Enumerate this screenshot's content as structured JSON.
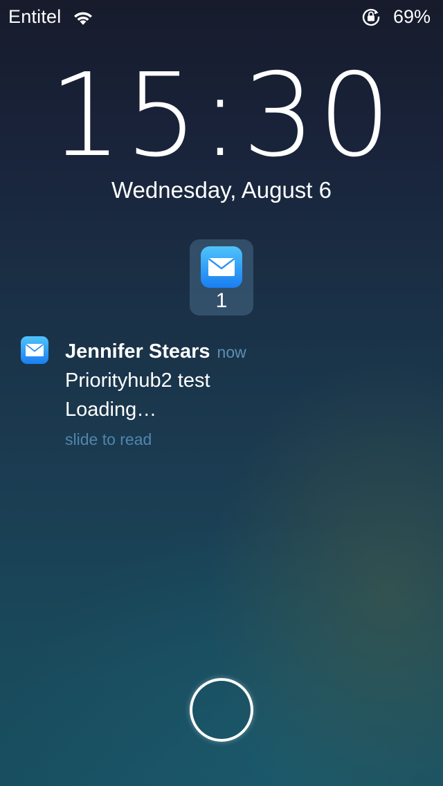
{
  "status_bar": {
    "carrier": "Entitel",
    "wifi_icon": "wifi-icon",
    "orientation_lock_icon": "orientation-lock-icon",
    "battery_percent": "69%"
  },
  "lock_screen": {
    "time": "15:30",
    "date": "Wednesday, August 6"
  },
  "app_group": {
    "icon": "mail-icon",
    "count": "1"
  },
  "notification": {
    "icon": "mail-icon",
    "sender": "Jennifer Stears",
    "time": "now",
    "subject": "Priorityhub2 test",
    "body": "Loading…",
    "action": "slide to read"
  },
  "home_button": {
    "icon": "home-button-ring"
  },
  "colors": {
    "accent_text": "#5b90b4",
    "mail_icon_top": "#4fc3fb",
    "mail_icon_bottom": "#1a7ef2",
    "background_top": "#171b2c",
    "background_bottom": "#184f60"
  }
}
